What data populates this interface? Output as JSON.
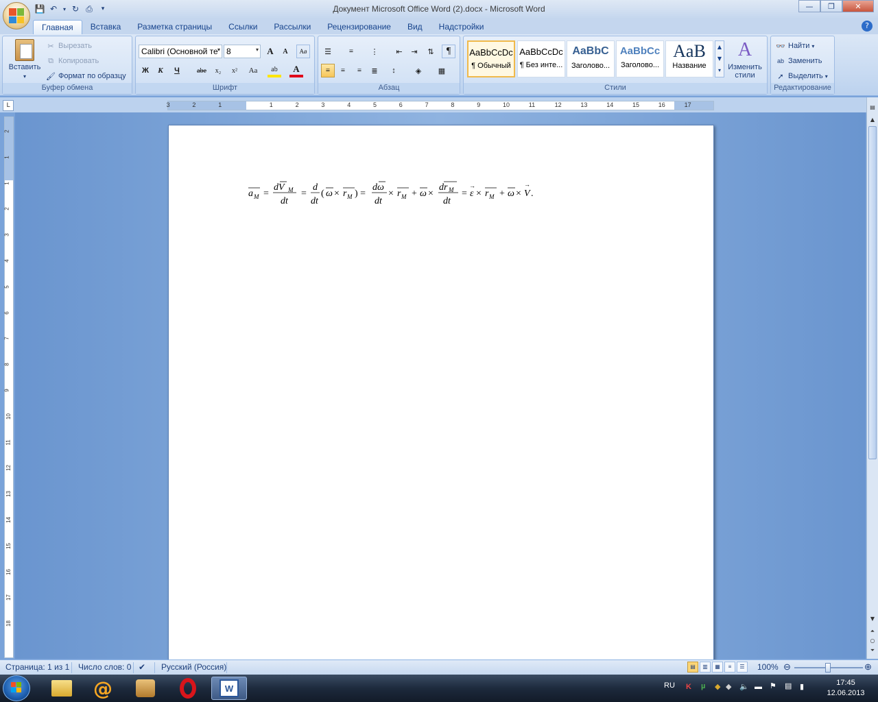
{
  "window": {
    "title": "Документ Microsoft Office Word (2).docx - Microsoft Word"
  },
  "tabs": [
    "Главная",
    "Вставка",
    "Разметка страницы",
    "Ссылки",
    "Рассылки",
    "Рецензирование",
    "Вид",
    "Надстройки"
  ],
  "clipboard": {
    "paste_label": "Вставить",
    "cut_label": "Вырезать",
    "copy_label": "Копировать",
    "format_painter_label": "Формат по образцу",
    "group_label": "Буфер обмена"
  },
  "font": {
    "font_name": "Calibri (Основной те",
    "font_size": "8",
    "bold": "Ж",
    "italic": "К",
    "underline": "Ч",
    "strike": "abe",
    "subscript": "x₂",
    "superscript": "x²",
    "change_case": "Aa",
    "grow": "A",
    "shrink": "A",
    "highlight": "ab",
    "font_color": "A",
    "group_label": "Шрифт"
  },
  "paragraph": {
    "group_label": "Абзац",
    "show_marks": "¶"
  },
  "styles": {
    "tiles": [
      {
        "sample": "AaBbCcDc",
        "name": "¶ Обычный"
      },
      {
        "sample": "AaBbCcDc",
        "name": "¶ Без инте..."
      },
      {
        "sample": "AaBbC",
        "name": "Заголово..."
      },
      {
        "sample": "AaBbCc",
        "name": "Заголово..."
      },
      {
        "sample": "AaB",
        "name": "Название"
      }
    ],
    "change_styles_label": "Изменить стили",
    "group_label": "Стили"
  },
  "editing": {
    "find_label": "Найти",
    "replace_label": "Заменить",
    "select_label": "Выделить",
    "group_label": "Редактирование"
  },
  "ruler": {
    "corner": "L",
    "left_marks": [
      "3",
      "2",
      "1"
    ],
    "marks": [
      "1",
      "2",
      "3",
      "4",
      "5",
      "6",
      "7",
      "8",
      "9",
      "10",
      "11",
      "12",
      "13",
      "14",
      "15",
      "16",
      "17"
    ],
    "vmarks": [
      "2",
      "1",
      "1",
      "2",
      "3",
      "4",
      "5",
      "6",
      "7",
      "8",
      "9",
      "10",
      "11",
      "12",
      "13",
      "14",
      "15",
      "16",
      "17",
      "18"
    ]
  },
  "status": {
    "page": "Страница: 1 из 1",
    "words": "Число слов: 0",
    "language": "Русский (Россия)",
    "zoom": "100%"
  },
  "taskbar": {
    "language": "RU",
    "time": "17:45",
    "date": "12.06.2013"
  },
  "colors": {
    "accent": "#15428b",
    "ribbon_bg": "#c9dbf2",
    "doc_bg": "#7aa3d9"
  }
}
